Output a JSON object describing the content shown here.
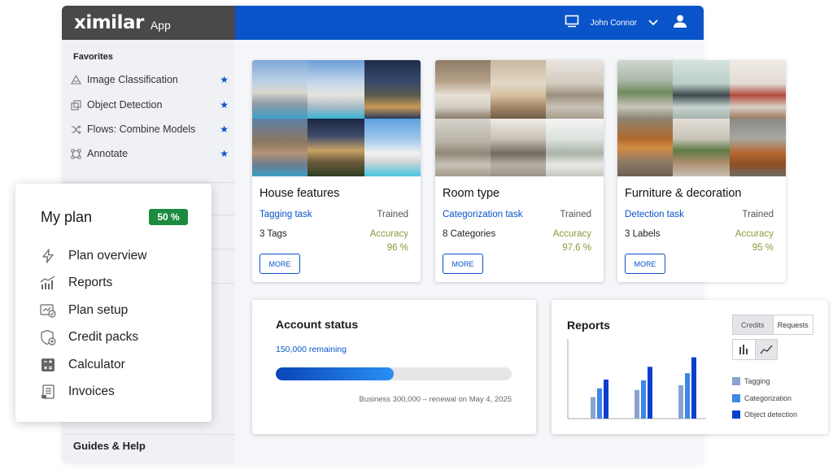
{
  "brand": {
    "logo": "ximilar",
    "app_label": "App"
  },
  "topbar": {
    "user_name": "John Connor",
    "icons": [
      "monitor-icon",
      "chevron-down-icon",
      "user-icon"
    ]
  },
  "sidebar": {
    "favorites_title": "Favorites",
    "favorites": [
      {
        "label": "Image Classification",
        "icon": "classification-icon"
      },
      {
        "label": "Object Detection",
        "icon": "detection-icon"
      },
      {
        "label": "Flows: Combine Models",
        "icon": "flows-icon"
      },
      {
        "label": "Annotate",
        "icon": "annotate-icon"
      }
    ],
    "guides_label": "Guides & Help"
  },
  "tasks": [
    {
      "title": "House features",
      "task_type": "Tagging task",
      "status": "Trained",
      "count": "3 Tags",
      "accuracy_label": "Accuracy",
      "accuracy_value": "96 %",
      "button": "MORE"
    },
    {
      "title": "Room type",
      "task_type": "Categorization task",
      "status": "Trained",
      "count": "8 Categories",
      "accuracy_label": "Accuracy",
      "accuracy_value": "97.6 %",
      "button": "MORE"
    },
    {
      "title": "Furniture & decoration",
      "task_type": "Detection task",
      "status": "Trained",
      "count": "3 Labels",
      "accuracy_label": "Accuracy",
      "accuracy_value": "95 %",
      "button": "MORE"
    }
  ],
  "account": {
    "title": "Account status",
    "remaining": "150,000 remaining",
    "progress": 0.5,
    "footer": "Business 300,000 – renewal on May 4, 2025"
  },
  "reports": {
    "title": "Reports",
    "tabs": [
      "Credits",
      "Requests"
    ],
    "active_tab": "Credits",
    "view_toggle": [
      "bar-chart-icon",
      "line-chart-icon"
    ],
    "legend": [
      "Tagging",
      "Categorization",
      "Object detection"
    ]
  },
  "chart_data": {
    "type": "bar",
    "categories": [
      "",
      "",
      ""
    ],
    "series": [
      {
        "name": "Tagging",
        "values": [
          27,
          36,
          42
        ]
      },
      {
        "name": "Categorization",
        "values": [
          38,
          48,
          57
        ]
      },
      {
        "name": "Object detection",
        "values": [
          49,
          65,
          77
        ]
      }
    ],
    "colors": [
      "#8aa4d0",
      "#3e86e8",
      "#0c3fd0"
    ],
    "ylim": [
      0,
      100
    ],
    "grid": false
  },
  "plan": {
    "title": "My plan",
    "badge": "50 %",
    "items": [
      {
        "label": "Plan overview",
        "icon": "lightning-icon"
      },
      {
        "label": "Reports",
        "icon": "reports-icon"
      },
      {
        "label": "Plan setup",
        "icon": "plan-setup-icon"
      },
      {
        "label": "Credit packs",
        "icon": "credit-packs-icon"
      },
      {
        "label": "Calculator",
        "icon": "calculator-icon"
      },
      {
        "label": "Invoices",
        "icon": "invoice-icon"
      }
    ]
  },
  "colors": {
    "primary": "#0a54c9",
    "brand_bar": "#494949",
    "badge": "#1c8a3f",
    "accuracy": "#8a9a3c"
  }
}
